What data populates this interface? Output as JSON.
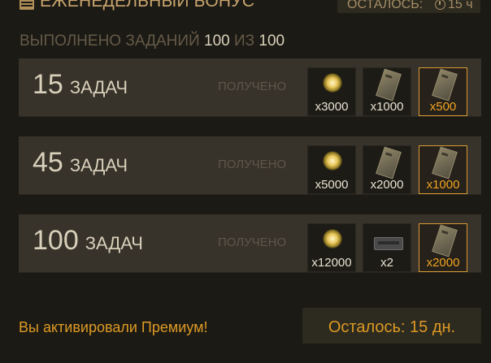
{
  "header": {
    "title": "ЕЖЕНЕДЕЛЬНЫЙ БОНУС",
    "timer_label": "ОСТАЛОСЬ:",
    "timer_value": "15 ч"
  },
  "progress": {
    "label": "ВЫПОЛНЕНО ЗАДАНИЙ",
    "done": "100",
    "of": "ИЗ",
    "total": "100"
  },
  "tiers": [
    {
      "count": "15",
      "unit": "ЗАДАЧ",
      "status": "ПОЛУЧЕНО",
      "rewards": [
        {
          "icon": "spark-icon",
          "amount": "x3000",
          "highlight": false
        },
        {
          "icon": "card-icon",
          "amount": "x1000",
          "highlight": false
        },
        {
          "icon": "card-icon",
          "amount": "x500",
          "highlight": true
        }
      ]
    },
    {
      "count": "45",
      "unit": "ЗАДАЧ",
      "status": "ПОЛУЧЕНО",
      "rewards": [
        {
          "icon": "spark-icon",
          "amount": "x5000",
          "highlight": false
        },
        {
          "icon": "card-icon",
          "amount": "x2000",
          "highlight": false
        },
        {
          "icon": "card-icon",
          "amount": "x1000",
          "highlight": true
        }
      ]
    },
    {
      "count": "100",
      "unit": "ЗАДАЧ",
      "status": "ПОЛУЧЕНО",
      "rewards": [
        {
          "icon": "spark-icon",
          "amount": "x12000",
          "highlight": false
        },
        {
          "icon": "box-icon",
          "amount": "x2",
          "highlight": false
        },
        {
          "icon": "card-icon",
          "amount": "x2000",
          "highlight": true
        }
      ]
    }
  ],
  "premium": {
    "message": "Вы активировали Премиум!",
    "remaining": "Осталось: 15 дн."
  },
  "colors": {
    "accent": "#dd9a23",
    "highlight_border": "#d79b32",
    "panel": "#37322a",
    "background": "#1c1a15"
  }
}
